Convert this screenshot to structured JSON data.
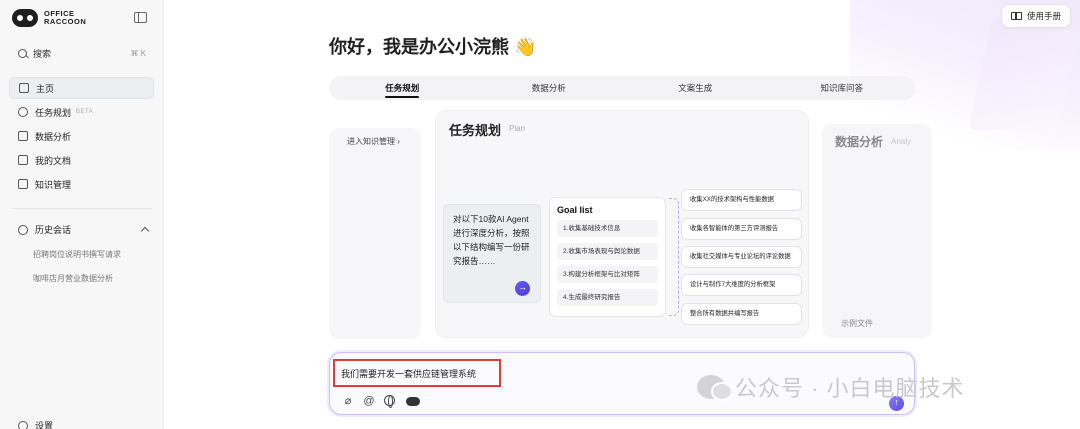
{
  "sidebar": {
    "logo_line1": "OFFICE",
    "logo_line2": "RACCOON",
    "search_label": "搜索",
    "search_shortcut": "⌘ K",
    "nav": [
      {
        "label": "主页",
        "icon": "home-icon"
      },
      {
        "label": "任务规划",
        "badge": "BETA",
        "icon": "task-icon"
      },
      {
        "label": "数据分析",
        "icon": "chart-icon"
      },
      {
        "label": "我的文档",
        "icon": "document-icon"
      },
      {
        "label": "知识管理",
        "icon": "knowledge-icon"
      }
    ],
    "history_title": "历史会话",
    "history": [
      "招聘岗位说明书撰写请求",
      "咖啡店月营业数据分析"
    ],
    "settings_label": "设置"
  },
  "header": {
    "manual_label": "使用手册",
    "greeting": "你好，我是办公小浣熊 👋"
  },
  "tabs": [
    "任务规划",
    "数据分析",
    "文案生成",
    "知识库问答"
  ],
  "carousel": {
    "left_link": "进入知识管理 ›",
    "plan_title": "任务规划",
    "plan_subtitle": "Plan",
    "prompt": "对以下10款AI Agent进行深度分析，按照以下结构编写一份研究报告……",
    "goal_title": "Goal list",
    "goals": [
      "1.收集基础技术信息",
      "2.收集市场表现与舆论数据",
      "3.构建分析框架与比对矩阵",
      "4.生成最终研究报告"
    ],
    "tasks": [
      "收集XX的技术架构与性能数据",
      "收集各智能体的第三方评测报告",
      "收集社交媒体与专业论坛的评论数据",
      "设计与制作7大维度的分析框架",
      "整合所有数据并编写报告"
    ],
    "right_title": "数据分析",
    "right_subtitle": "Analy",
    "example_file": "示例文件"
  },
  "input": {
    "value": "我们需要开发一套供应链管理系统"
  },
  "watermark": "公众号 · 小白电脑技术"
}
